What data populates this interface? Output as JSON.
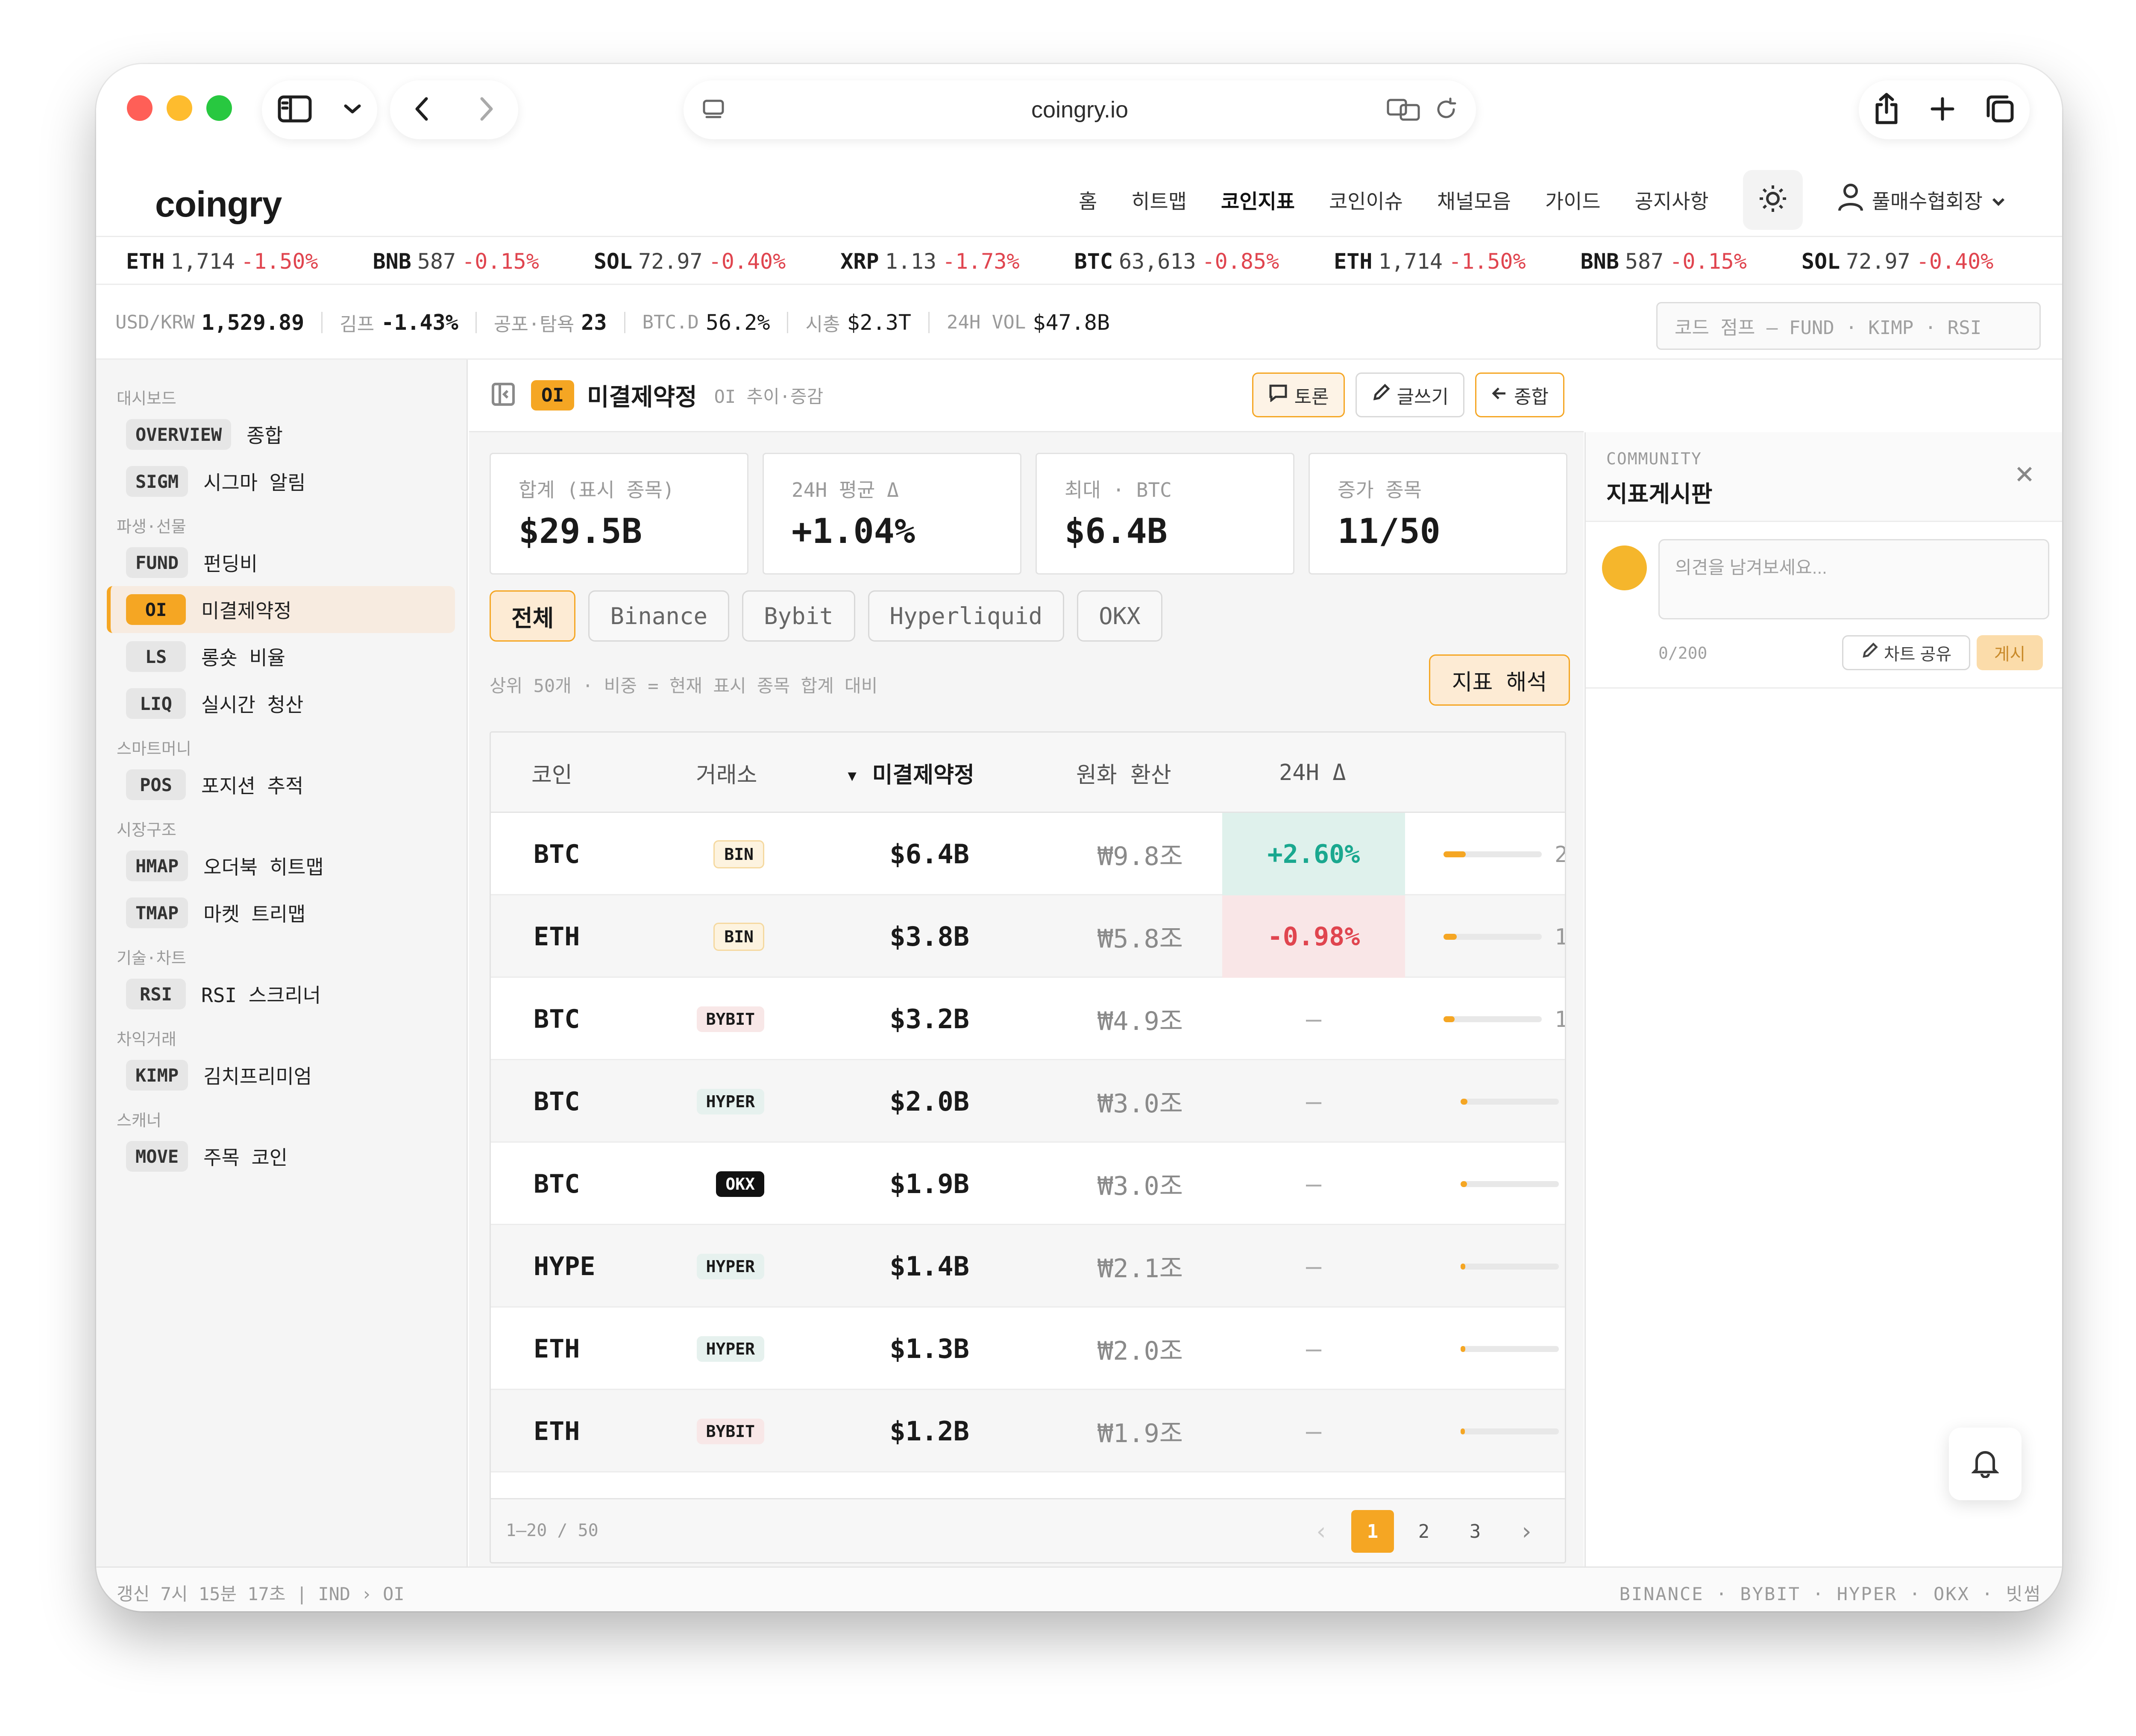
{
  "browser": {
    "url": "coingry.io"
  },
  "site": {
    "logo": "coingry",
    "nav": [
      "홈",
      "히트맵",
      "코인지표",
      "코인이슈",
      "채널모음",
      "가이드",
      "공지사항"
    ],
    "active_nav": "코인지표",
    "user": "풀매수협회장"
  },
  "ticker": [
    {
      "sym": "ETH",
      "price": "1,714",
      "chg": "-1.50%",
      "dir": "neg"
    },
    {
      "sym": "BNB",
      "price": "587",
      "chg": "-0.15%",
      "dir": "neg"
    },
    {
      "sym": "SOL",
      "price": "72.97",
      "chg": "-0.40%",
      "dir": "neg"
    },
    {
      "sym": "XRP",
      "price": "1.13",
      "chg": "-1.73%",
      "dir": "neg"
    },
    {
      "sym": "BTC",
      "price": "63,613",
      "chg": "-0.85%",
      "dir": "neg"
    },
    {
      "sym": "ETH",
      "price": "1,714",
      "chg": "-1.50%",
      "dir": "neg"
    },
    {
      "sym": "BNB",
      "price": "587",
      "chg": "-0.15%",
      "dir": "neg"
    },
    {
      "sym": "SOL",
      "price": "72.97",
      "chg": "-0.40%",
      "dir": "neg"
    }
  ],
  "stats": {
    "usdkrw_label": "USD/KRW",
    "usdkrw": "1,529.89",
    "kimp_label": "김프",
    "kimp": "-1.43%",
    "fear_label": "공포·탐욕",
    "fear": "23",
    "btcd_label": "BTC.D",
    "btcd": "56.2%",
    "mcap_label": "시총",
    "mcap": "$2.3T",
    "vol_label": "24H VOL",
    "vol": "$47.8B",
    "code_jump": "코드 점프 — FUND · KIMP · RSI"
  },
  "sidebar": {
    "sections": [
      {
        "title": "대시보드",
        "items": [
          {
            "code": "OVERVIEW",
            "label": "종합"
          },
          {
            "code": "SIGM",
            "label": "시그마 알림"
          }
        ]
      },
      {
        "title": "파생·선물",
        "items": [
          {
            "code": "FUND",
            "label": "펀딩비"
          },
          {
            "code": "OI",
            "label": "미결제약정",
            "active": true
          },
          {
            "code": "LS",
            "label": "롱숏 비율"
          },
          {
            "code": "LIQ",
            "label": "실시간 청산"
          }
        ]
      },
      {
        "title": "스마트머니",
        "items": [
          {
            "code": "POS",
            "label": "포지션 추적"
          }
        ]
      },
      {
        "title": "시장구조",
        "items": [
          {
            "code": "HMAP",
            "label": "오더북 히트맵"
          },
          {
            "code": "TMAP",
            "label": "마켓 트리맵"
          }
        ]
      },
      {
        "title": "기술·차트",
        "items": [
          {
            "code": "RSI",
            "label": "RSI 스크리너"
          }
        ]
      },
      {
        "title": "차익거래",
        "items": [
          {
            "code": "KIMP",
            "label": "김치프리미엄"
          }
        ]
      },
      {
        "title": "스캐너",
        "items": [
          {
            "code": "MOVE",
            "label": "주목 코인"
          }
        ]
      }
    ]
  },
  "main": {
    "badge": "OI",
    "title": "미결제약정",
    "subtitle": "OI 추이·증감",
    "btn_discuss": "토론",
    "btn_write": "글쓰기",
    "btn_back": "종합",
    "cards": [
      {
        "label": "합계 (표시 종목)",
        "value": "$29.5B",
        "tone": "default"
      },
      {
        "label": "24H 평균 Δ",
        "value": "+1.04%",
        "tone": "pos"
      },
      {
        "label": "최대 · BTC",
        "value": "$6.4B",
        "tone": "default"
      },
      {
        "label": "증가 종목",
        "value": "11/50",
        "tone": "neg"
      }
    ],
    "filters": [
      "전체",
      "Binance",
      "Bybit",
      "Hyperliquid",
      "OKX"
    ],
    "active_filter": "전체",
    "filter_note": "상위 50개 · 비중 = 현재 표시 종목 합계 대비",
    "interpret_btn": "지표 해석",
    "table": {
      "headers": {
        "coin": "코인",
        "exchange": "거래소",
        "oi": "▾ 미결제약정",
        "krw": "원화 환산",
        "chg": "24H Δ"
      },
      "rows": [
        {
          "coin": "BTC",
          "ex": "BIN",
          "ex_type": "bin",
          "oi": "$6.4B",
          "krw": "₩9.8조",
          "chg": "+2.60%",
          "chg_tone": "pos",
          "share": 0.217,
          "tail": "2"
        },
        {
          "coin": "ETH",
          "ex": "BIN",
          "ex_type": "bin",
          "oi": "$3.8B",
          "krw": "₩5.8조",
          "chg": "-0.98%",
          "chg_tone": "neg",
          "share": 0.129,
          "tail": "1"
        },
        {
          "coin": "BTC",
          "ex": "BYBIT",
          "ex_type": "bybit",
          "oi": "$3.2B",
          "krw": "₩4.9조",
          "chg": "—",
          "chg_tone": "none",
          "share": 0.108,
          "tail": "1"
        },
        {
          "coin": "BTC",
          "ex": "HYPER",
          "ex_type": "hyper",
          "oi": "$2.0B",
          "krw": "₩3.0조",
          "chg": "—",
          "chg_tone": "none",
          "share": 0.068,
          "tail": ""
        },
        {
          "coin": "BTC",
          "ex": "OKX",
          "ex_type": "okx",
          "oi": "$1.9B",
          "krw": "₩3.0조",
          "chg": "—",
          "chg_tone": "none",
          "share": 0.064,
          "tail": ""
        },
        {
          "coin": "HYPE",
          "ex": "HYPER",
          "ex_type": "hyper",
          "oi": "$1.4B",
          "krw": "₩2.1조",
          "chg": "—",
          "chg_tone": "none",
          "share": 0.047,
          "tail": ""
        },
        {
          "coin": "ETH",
          "ex": "HYPER",
          "ex_type": "hyper",
          "oi": "$1.3B",
          "krw": "₩2.0조",
          "chg": "—",
          "chg_tone": "none",
          "share": 0.044,
          "tail": ""
        },
        {
          "coin": "ETH",
          "ex": "BYBIT",
          "ex_type": "bybit",
          "oi": "$1.2B",
          "krw": "₩1.9조",
          "chg": "—",
          "chg_tone": "none",
          "share": 0.041,
          "tail": ""
        }
      ],
      "footer_info": "1–20 / 50",
      "pages": [
        "1",
        "2",
        "3"
      ],
      "current_page": "1"
    }
  },
  "community": {
    "small": "COMMUNITY",
    "title": "지표게시판",
    "placeholder": "의견을 남겨보세요...",
    "char_count": "0/200",
    "share_btn": "차트 공유",
    "post_btn": "게시"
  },
  "bottom": {
    "left": "갱신 7시 15분 17초  |  IND › OI",
    "right": "BINANCE · BYBIT · HYPER · OKX · 빗썸"
  },
  "colors": {
    "accent": "#f5a623",
    "positive": "#1aa88f",
    "negative": "#e0454f"
  }
}
